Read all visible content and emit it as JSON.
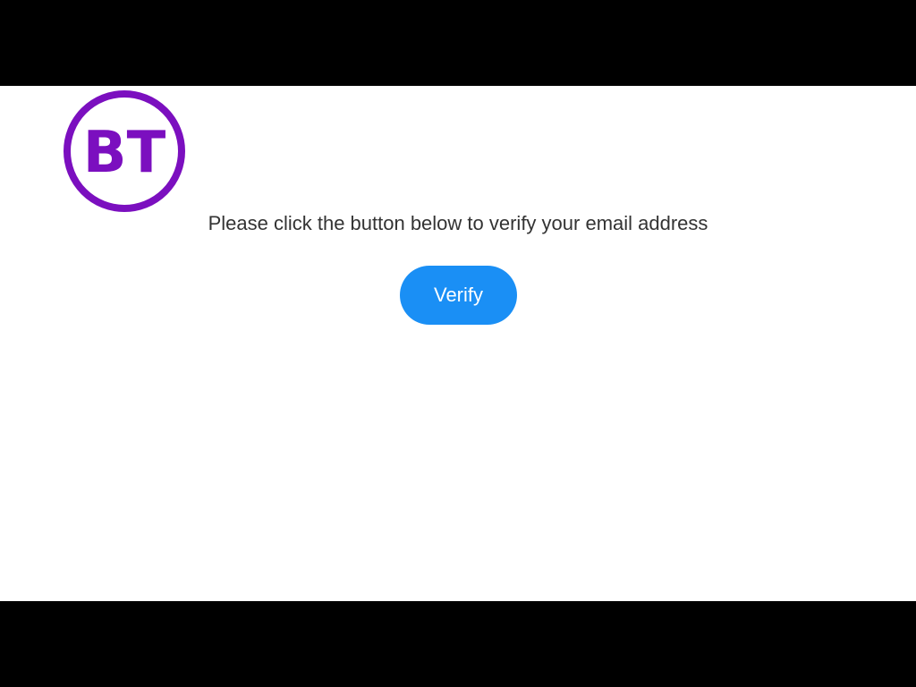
{
  "brand": {
    "logo_text": "BT",
    "logo_color": "#7b0fbf"
  },
  "main": {
    "message": "Please click the button below to verify your email address",
    "verify_button_label": "Verify",
    "button_color": "#1a8ff5"
  }
}
